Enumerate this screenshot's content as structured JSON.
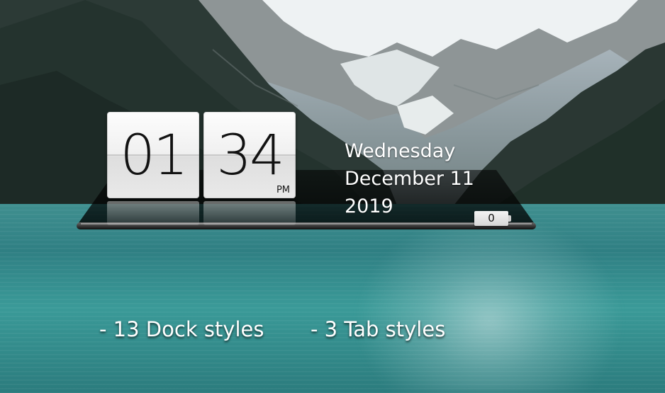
{
  "clock": {
    "hours": "01",
    "minutes": "34",
    "ampm": "PM"
  },
  "date": {
    "weekday": "Wednesday",
    "month_day": "December 11",
    "year": "2019"
  },
  "battery": {
    "level": "0"
  },
  "features": {
    "dock_styles": "- 13 Dock styles",
    "tab_styles": "- 3 Tab styles"
  },
  "colors": {
    "text": "#ffffff",
    "flip_card": "#f0f0f0",
    "digit": "#121212",
    "lake": "#3a9a98",
    "shelf": "#1c1c1c"
  }
}
